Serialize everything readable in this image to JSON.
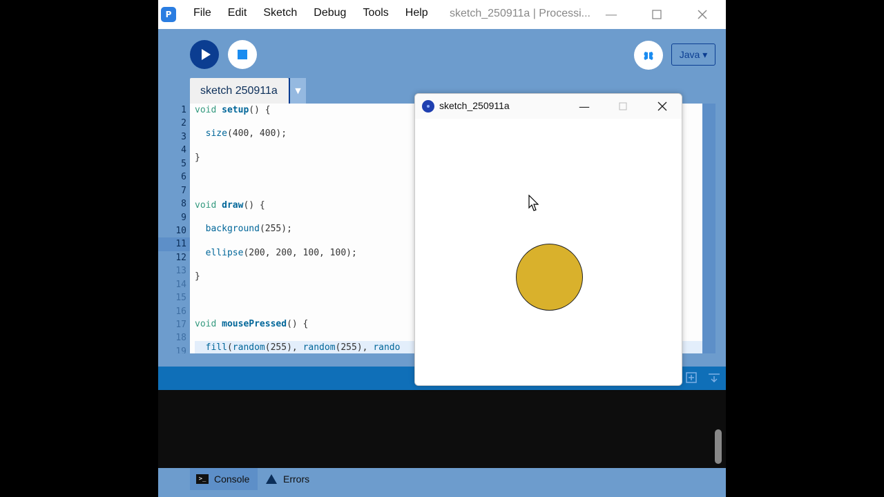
{
  "ide": {
    "menu": [
      "File",
      "Edit",
      "Sketch",
      "Debug",
      "Tools",
      "Help"
    ],
    "window_title": "sketch_250911a | Processi...",
    "mode_label": "Java ▾",
    "tab_label": "sketch 250911a",
    "tab_arrow": "▼",
    "line_numbers": [
      "1",
      "2",
      "3",
      "4",
      "5",
      "6",
      "7",
      "8",
      "9",
      "10",
      "11",
      "12",
      "13",
      "14",
      "15",
      "16",
      "17",
      "18",
      "19"
    ],
    "current_line": 11,
    "code_lines": [
      "void setup() {",
      "  size(400, 400);",
      "}",
      "",
      "void draw() {",
      "  background(255);",
      "  ellipse(200, 200, 100, 100);",
      "}",
      "",
      "void mousePressed() {",
      "  fill(random(255), random(255), rando",
      "}"
    ],
    "bottom_tabs": {
      "console": "Console",
      "errors": "Errors"
    }
  },
  "sketch_window": {
    "title": "sketch_250911a",
    "ellipse_color": "#d9b12c"
  },
  "colors": {
    "ide_bg": "#6d9ccd",
    "run_button": "#0b3d91",
    "status_bar": "#0f6fb8"
  }
}
